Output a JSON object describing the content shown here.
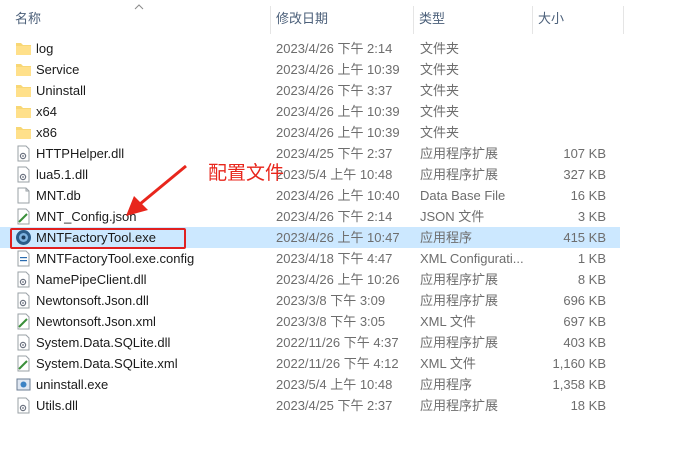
{
  "columns": {
    "name": "名称",
    "date": "修改日期",
    "type": "类型",
    "size": "大小"
  },
  "annotation": {
    "label": "配置文件",
    "color": "#e8261c"
  },
  "files": [
    {
      "name": "log",
      "date": "2023/4/26 下午 2:14",
      "type": "文件夹",
      "size": "",
      "icon": "folder-icon"
    },
    {
      "name": "Service",
      "date": "2023/4/26 上午 10:39",
      "type": "文件夹",
      "size": "",
      "icon": "folder-icon"
    },
    {
      "name": "Uninstall",
      "date": "2023/4/26 下午 3:37",
      "type": "文件夹",
      "size": "",
      "icon": "folder-icon"
    },
    {
      "name": "x64",
      "date": "2023/4/26 上午 10:39",
      "type": "文件夹",
      "size": "",
      "icon": "folder-icon"
    },
    {
      "name": "x86",
      "date": "2023/4/26 上午 10:39",
      "type": "文件夹",
      "size": "",
      "icon": "folder-icon"
    },
    {
      "name": "HTTPHelper.dll",
      "date": "2023/4/25 下午 2:37",
      "type": "应用程序扩展",
      "size": "107 KB",
      "icon": "dll-icon"
    },
    {
      "name": "lua5.1.dll",
      "date": "2023/5/4 上午 10:48",
      "type": "应用程序扩展",
      "size": "327 KB",
      "icon": "dll-icon"
    },
    {
      "name": "MNT.db",
      "date": "2023/4/26 上午 10:40",
      "type": "Data Base File",
      "size": "16 KB",
      "icon": "file-icon"
    },
    {
      "name": "MNT_Config.json",
      "date": "2023/4/26 下午 2:14",
      "type": "JSON 文件",
      "size": "3 KB",
      "icon": "json-file-icon"
    },
    {
      "name": "MNTFactoryTool.exe",
      "date": "2023/4/26 上午 10:47",
      "type": "应用程序",
      "size": "415 KB",
      "icon": "app-icon",
      "selected": true
    },
    {
      "name": "MNTFactoryTool.exe.config",
      "date": "2023/4/18 下午 4:47",
      "type": "XML Configurati...",
      "size": "1 KB",
      "icon": "config-icon"
    },
    {
      "name": "NamePipeClient.dll",
      "date": "2023/4/26 上午 10:26",
      "type": "应用程序扩展",
      "size": "8 KB",
      "icon": "dll-icon"
    },
    {
      "name": "Newtonsoft.Json.dll",
      "date": "2023/3/8 下午 3:09",
      "type": "应用程序扩展",
      "size": "696 KB",
      "icon": "dll-icon"
    },
    {
      "name": "Newtonsoft.Json.xml",
      "date": "2023/3/8 下午 3:05",
      "type": "XML 文件",
      "size": "697 KB",
      "icon": "xml-file-icon"
    },
    {
      "name": "System.Data.SQLite.dll",
      "date": "2022/11/26 下午 4:37",
      "type": "应用程序扩展",
      "size": "403 KB",
      "icon": "dll-icon"
    },
    {
      "name": "System.Data.SQLite.xml",
      "date": "2022/11/26 下午 4:12",
      "type": "XML 文件",
      "size": "1,160 KB",
      "icon": "xml-file-icon"
    },
    {
      "name": "uninstall.exe",
      "date": "2023/5/4 上午 10:48",
      "type": "应用程序",
      "size": "1,358 KB",
      "icon": "installer-icon"
    },
    {
      "name": "Utils.dll",
      "date": "2023/4/25 下午 2:37",
      "type": "应用程序扩展",
      "size": "18 KB",
      "icon": "dll-icon"
    }
  ]
}
